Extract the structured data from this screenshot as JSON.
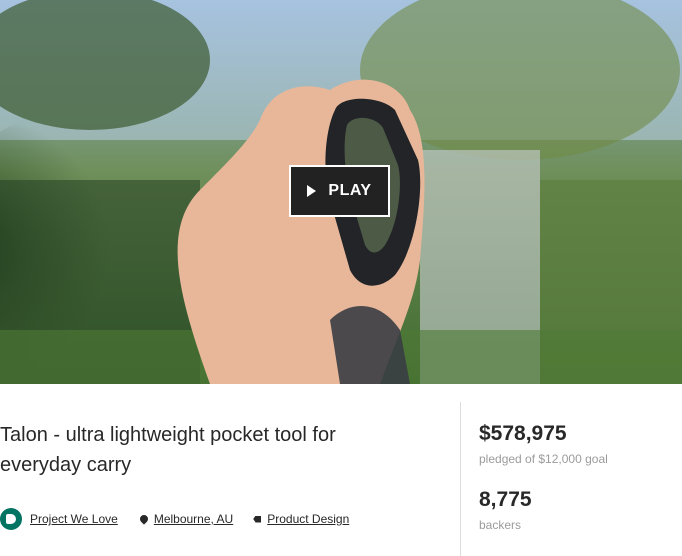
{
  "video": {
    "play_label": "PLAY",
    "icons": {
      "play": "play-icon"
    }
  },
  "project": {
    "title": "Talon - ultra lightweight pocket tool for everyday carry",
    "badge_label": "Project We Love",
    "location": "Melbourne, AU",
    "category": "Product Design"
  },
  "stats": {
    "pledged": "$578,975",
    "pledged_sub": "pledged of $12,000 goal",
    "backers": "8,775",
    "backers_sub": "backers"
  },
  "colors": {
    "accent": "#037362",
    "text": "#282828",
    "muted": "#9b9b9b"
  },
  "icons": {
    "badge": "project-we-love-icon",
    "location": "location-pin-icon",
    "category": "tag-icon"
  }
}
